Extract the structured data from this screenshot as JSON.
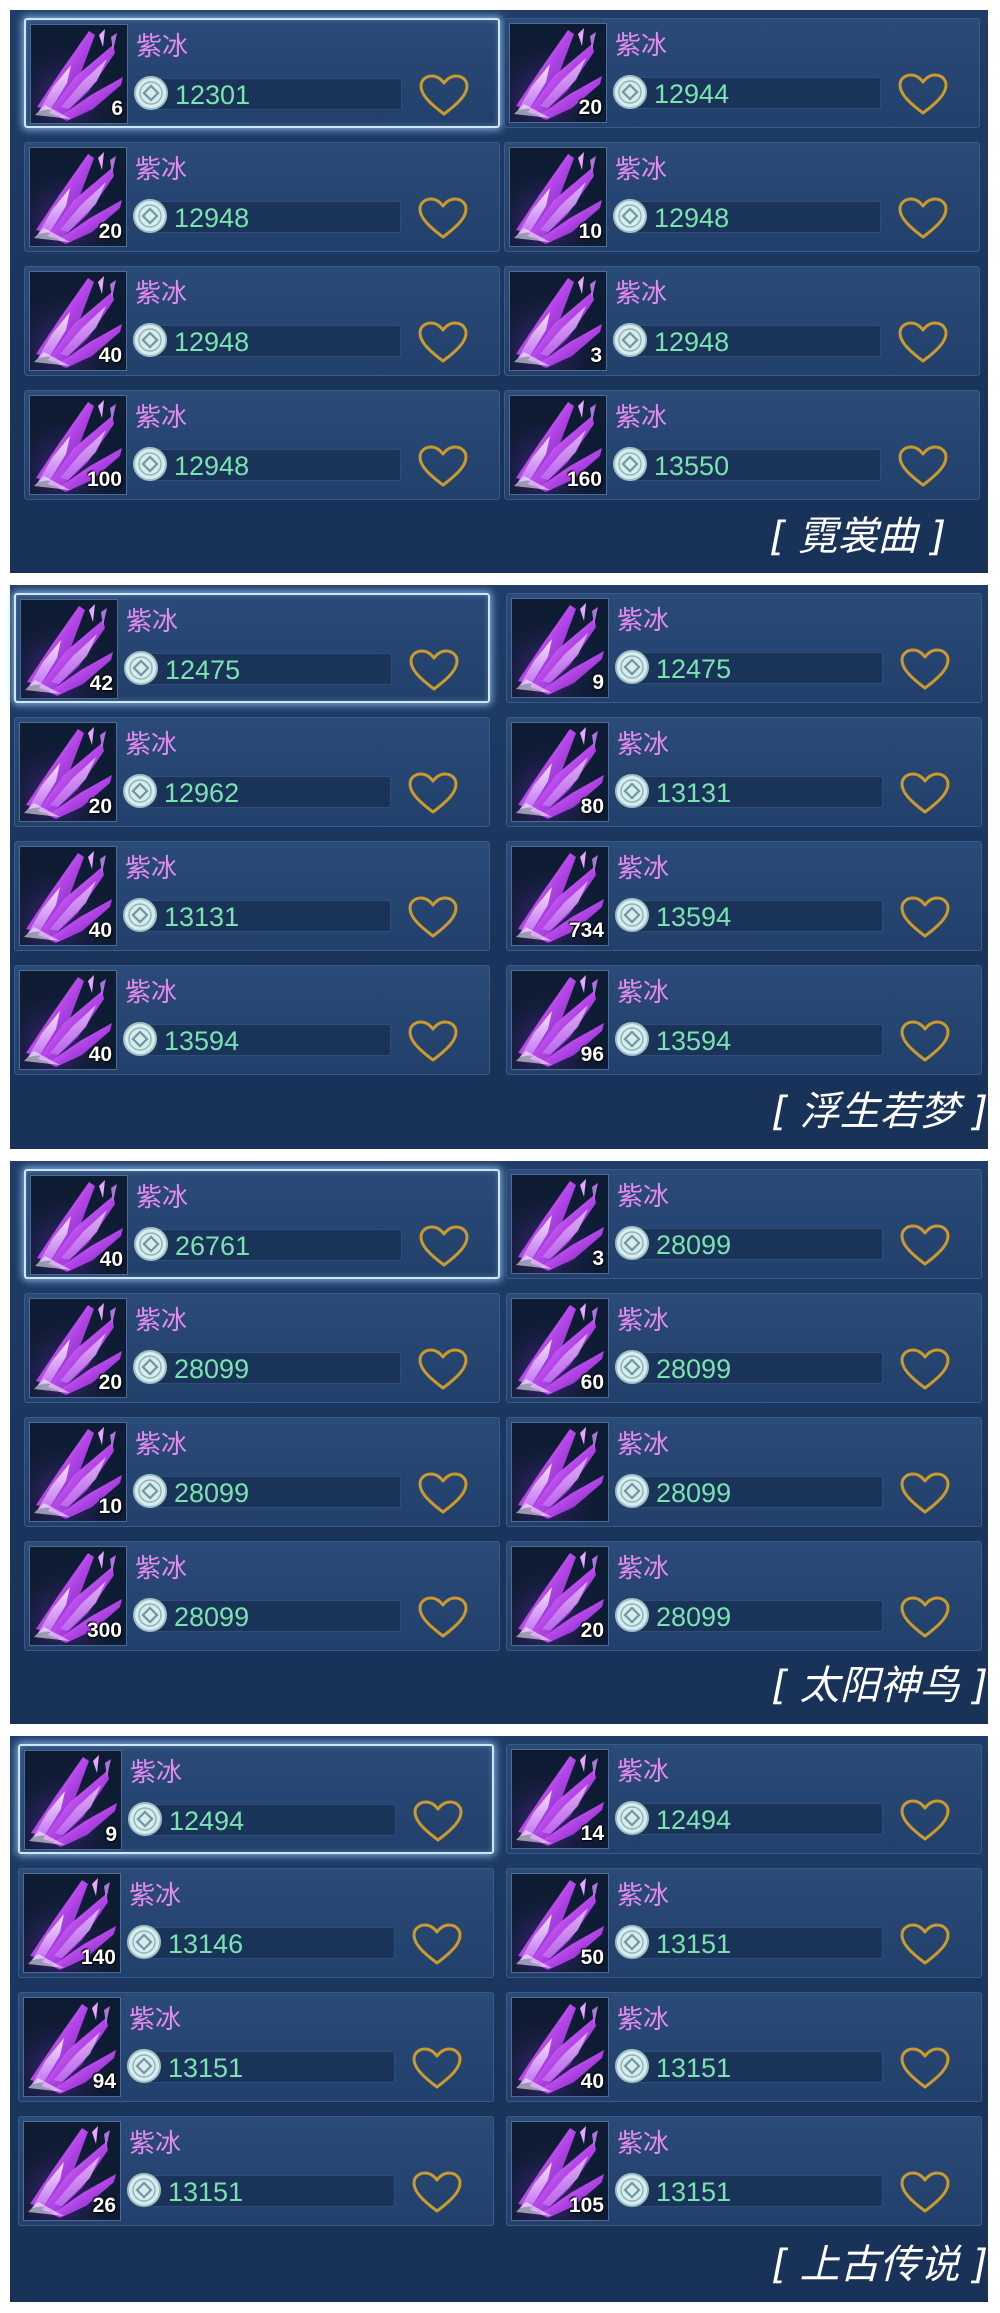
{
  "item_name": "紫冰",
  "colors": {
    "panel": "#1f3d68",
    "card": "#2a4a78",
    "name": "#e58bf0",
    "price": "#7ae3b0",
    "heart": "#c99a2e",
    "selected_border": "#cfe6ff"
  },
  "icons": {
    "item": "purple-crystal-icon",
    "currency": "silver-coin-icon",
    "favorite": "heart-outline-icon"
  },
  "panels": [
    {
      "server": "[ 霓裳曲 ]",
      "listings": [
        {
          "name": "紫冰",
          "qty": "6",
          "price": "12301",
          "selected": true
        },
        {
          "name": "紫冰",
          "qty": "20",
          "price": "12944",
          "selected": false
        },
        {
          "name": "紫冰",
          "qty": "20",
          "price": "12948",
          "selected": false
        },
        {
          "name": "紫冰",
          "qty": "10",
          "price": "12948",
          "selected": false
        },
        {
          "name": "紫冰",
          "qty": "40",
          "price": "12948",
          "selected": false
        },
        {
          "name": "紫冰",
          "qty": "3",
          "price": "12948",
          "selected": false
        },
        {
          "name": "紫冰",
          "qty": "100",
          "price": "12948",
          "selected": false
        },
        {
          "name": "紫冰",
          "qty": "160",
          "price": "13550",
          "selected": false
        }
      ]
    },
    {
      "server": "[ 浮生若梦 ]",
      "listings": [
        {
          "name": "紫冰",
          "qty": "42",
          "price": "12475",
          "selected": true
        },
        {
          "name": "紫冰",
          "qty": "9",
          "price": "12475",
          "selected": false
        },
        {
          "name": "紫冰",
          "qty": "20",
          "price": "12962",
          "selected": false
        },
        {
          "name": "紫冰",
          "qty": "80",
          "price": "13131",
          "selected": false
        },
        {
          "name": "紫冰",
          "qty": "40",
          "price": "13131",
          "selected": false
        },
        {
          "name": "紫冰",
          "qty": "734",
          "price": "13594",
          "selected": false
        },
        {
          "name": "紫冰",
          "qty": "40",
          "price": "13594",
          "selected": false
        },
        {
          "name": "紫冰",
          "qty": "96",
          "price": "13594",
          "selected": false
        }
      ]
    },
    {
      "server": "[ 太阳神鸟 ]",
      "listings": [
        {
          "name": "紫冰",
          "qty": "40",
          "price": "26761",
          "selected": true
        },
        {
          "name": "紫冰",
          "qty": "3",
          "price": "28099",
          "selected": false
        },
        {
          "name": "紫冰",
          "qty": "20",
          "price": "28099",
          "selected": false
        },
        {
          "name": "紫冰",
          "qty": "60",
          "price": "28099",
          "selected": false
        },
        {
          "name": "紫冰",
          "qty": "10",
          "price": "28099",
          "selected": false
        },
        {
          "name": "紫冰",
          "qty": "",
          "price": "28099",
          "selected": false
        },
        {
          "name": "紫冰",
          "qty": "300",
          "price": "28099",
          "selected": false
        },
        {
          "name": "紫冰",
          "qty": "20",
          "price": "28099",
          "selected": false
        }
      ]
    },
    {
      "server": "[ 上古传说 ]",
      "listings": [
        {
          "name": "紫冰",
          "qty": "9",
          "price": "12494",
          "selected": true
        },
        {
          "name": "紫冰",
          "qty": "14",
          "price": "12494",
          "selected": false
        },
        {
          "name": "紫冰",
          "qty": "140",
          "price": "13146",
          "selected": false
        },
        {
          "name": "紫冰",
          "qty": "50",
          "price": "13151",
          "selected": false
        },
        {
          "name": "紫冰",
          "qty": "94",
          "price": "13151",
          "selected": false
        },
        {
          "name": "紫冰",
          "qty": "40",
          "price": "13151",
          "selected": false
        },
        {
          "name": "紫冰",
          "qty": "26",
          "price": "13151",
          "selected": false
        },
        {
          "name": "紫冰",
          "qty": "105",
          "price": "13151",
          "selected": false
        }
      ]
    }
  ]
}
